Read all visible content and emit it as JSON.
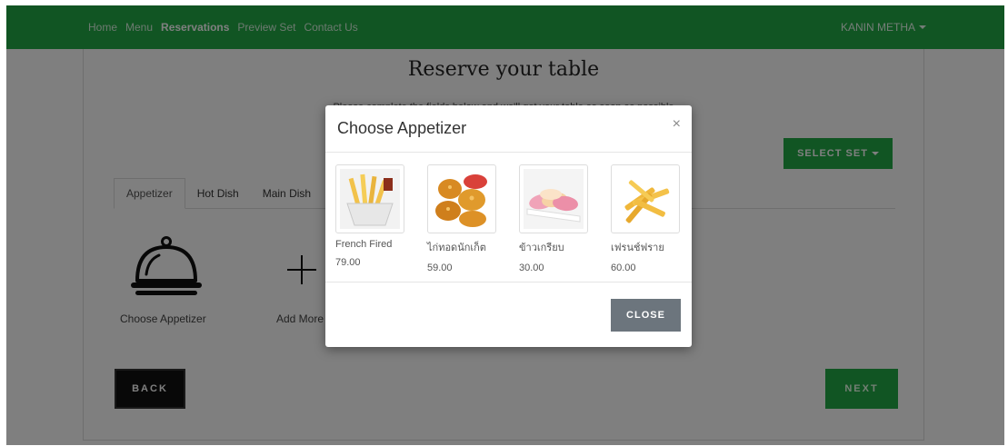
{
  "navbar": {
    "links": [
      "Home",
      "Menu",
      "Reservations",
      "Preview Set",
      "Contact Us"
    ],
    "active_index": 2,
    "user": "KANIN METHA",
    "color": "#22ab47"
  },
  "page": {
    "title": "Reserve your table",
    "subtitle": "Please complete the fields below and we'll get your table as soon as possible",
    "select_set_label": "SELECT SET",
    "tabs": [
      "Appetizer",
      "Hot Dish",
      "Main Dish"
    ],
    "choose_label": "Choose Appetizer",
    "add_more_label": "Add More",
    "back_label": "BACK",
    "next_label": "NEXT"
  },
  "modal": {
    "title": "Choose Appetizer",
    "close_glyph": "×",
    "close_label": "CLOSE",
    "items": [
      {
        "name": "French Fired",
        "price": "79.00",
        "icon": "french-fries-icon"
      },
      {
        "name": "ไก่ทอดนักเก็ต",
        "price": "59.00",
        "icon": "chicken-nuggets-icon"
      },
      {
        "name": "ข้าวเกรียบ",
        "price": "30.00",
        "icon": "rice-cracker-icon"
      },
      {
        "name": "เฟรนช์ฟราย",
        "price": "60.00",
        "icon": "fries-icon"
      }
    ]
  }
}
